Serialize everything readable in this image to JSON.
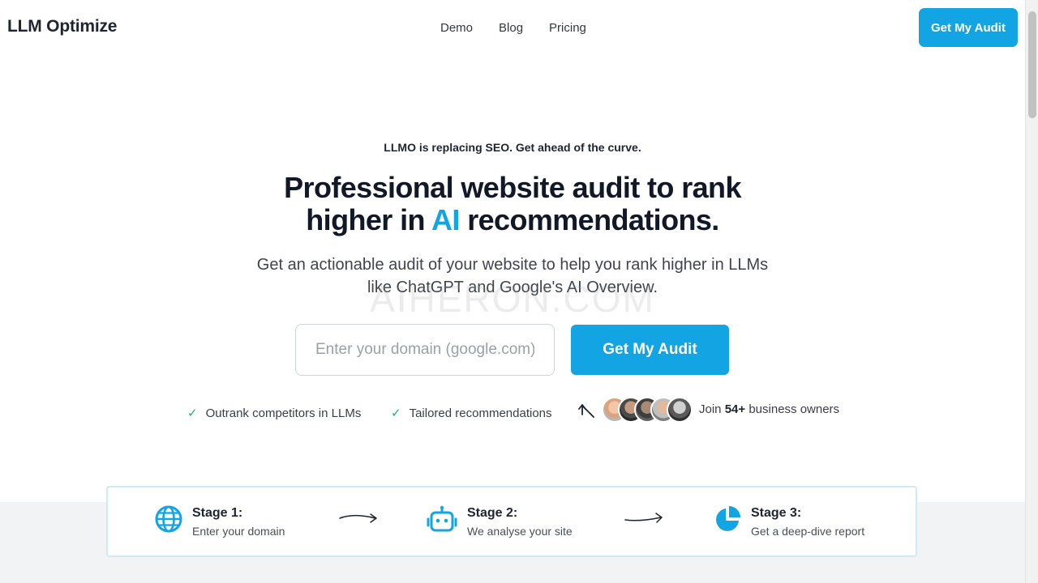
{
  "header": {
    "logo": "LLM Optimize",
    "nav": [
      "Demo",
      "Blog",
      "Pricing"
    ],
    "cta_label": "Get My Audit"
  },
  "hero": {
    "kicker": "LLMO is replacing SEO. Get ahead of the curve.",
    "title_part1": "Professional website audit to rank",
    "title_part2_prefix": "higher in",
    "title_highlight": "AI",
    "title_part2_suffix": "recommendations.",
    "subtitle": "Get an actionable audit of your website to help you rank higher in LLMs like ChatGPT and Google's AI Overview.",
    "watermark": "AIHERON.COM",
    "input_placeholder": "Enter your domain (google.com)",
    "input_value": "",
    "cta_label": "Get My Audit",
    "features": [
      "Outrank competitors in LLMs",
      "Tailored recommendations"
    ],
    "social_prefix": "Join",
    "social_count": "54+",
    "social_suffix": "business owners"
  },
  "stages": [
    {
      "title": "Stage 1:",
      "desc": "Enter your domain",
      "icon": "globe-icon"
    },
    {
      "title": "Stage 2:",
      "desc": "We analyse your site",
      "icon": "robot-icon"
    },
    {
      "title": "Stage 3:",
      "desc": "Get a deep-dive report",
      "icon": "pie-chart-icon"
    }
  ],
  "colors": {
    "accent": "#12a4e3",
    "check": "#1bb36b",
    "text_dark": "#111827",
    "band": "#f2f3f5"
  }
}
